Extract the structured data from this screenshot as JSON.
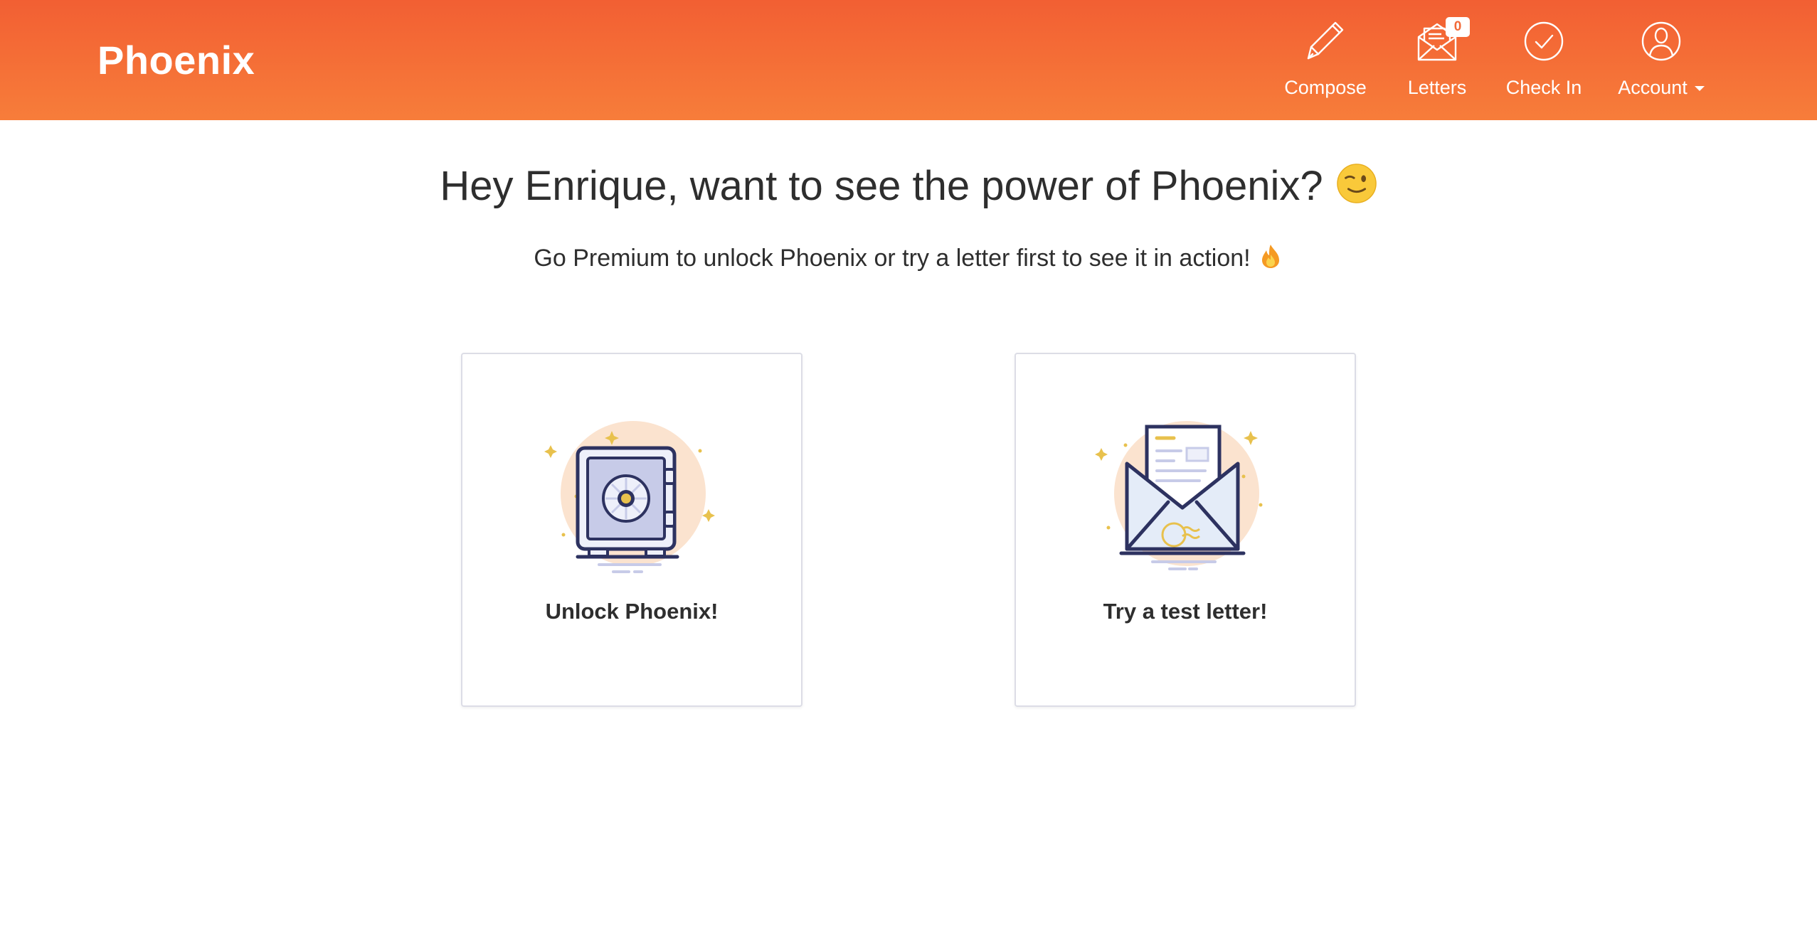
{
  "header": {
    "brand": "Phoenix",
    "nav": {
      "compose": {
        "label": "Compose",
        "icon": "pencil-icon"
      },
      "letters": {
        "label": "Letters",
        "icon": "envelope-icon",
        "badge": "0"
      },
      "checkin": {
        "label": "Check In",
        "icon": "check-circle-icon"
      },
      "account": {
        "label": "Account",
        "icon": "user-circle-icon"
      }
    }
  },
  "main": {
    "headline": "Hey Enrique, want to see the power of Phoenix?",
    "headline_emoji": "winking-face-emoji",
    "subline": "Go Premium to unlock Phoenix or try a letter first to see it in action!",
    "subline_emoji": "fire-emoji",
    "cards": {
      "unlock": {
        "label": "Unlock Phoenix!",
        "icon": "safe-vault-icon"
      },
      "test": {
        "label": "Try a test letter!",
        "icon": "open-envelope-letter-icon"
      }
    }
  },
  "colors": {
    "header_gradient_top": "#f25f33",
    "header_gradient_bottom": "#f77d3a",
    "illustration_navy": "#2d3260",
    "illustration_lavender": "#c7cbe8",
    "illustration_peach": "#fbe3cf",
    "illustration_gold": "#e8c14d"
  }
}
